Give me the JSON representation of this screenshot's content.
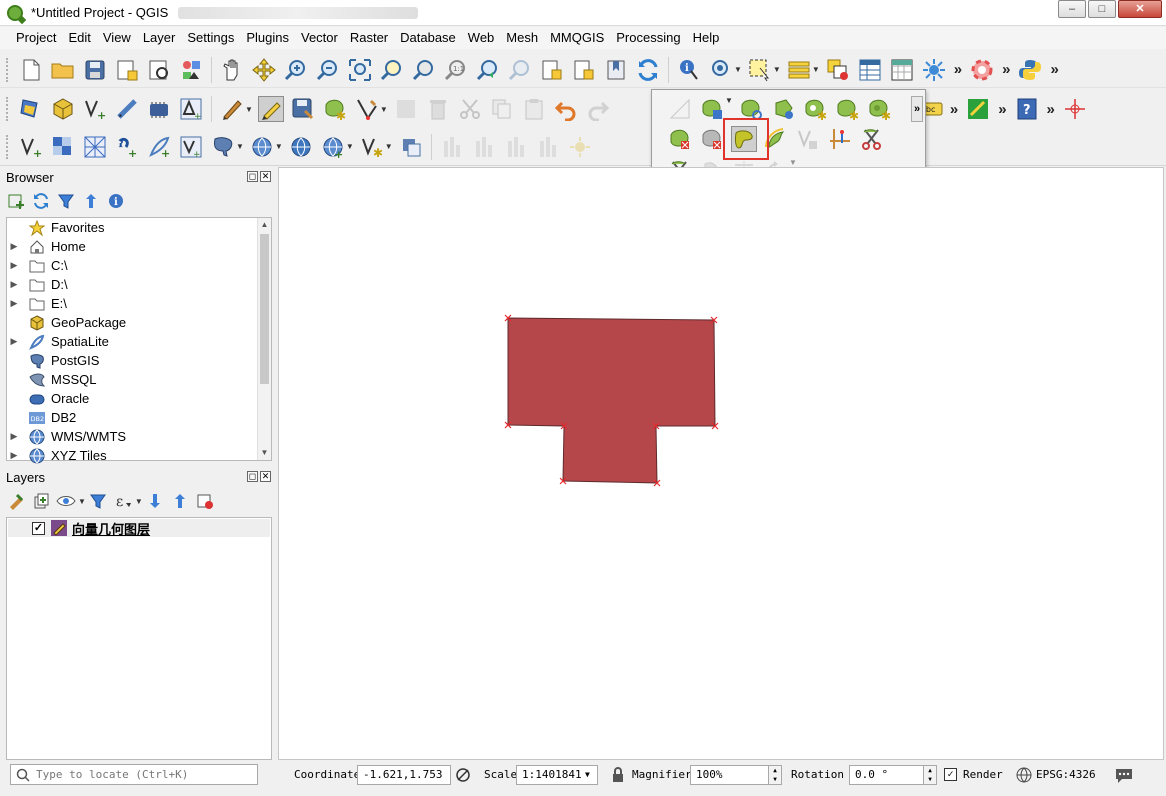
{
  "window": {
    "title": "*Untitled Project - QGIS",
    "controls": {
      "minimize": "–",
      "maximize": "□",
      "close": "✕"
    }
  },
  "menu": [
    "Project",
    "Edit",
    "View",
    "Layer",
    "Settings",
    "Plugins",
    "Vector",
    "Raster",
    "Database",
    "Web",
    "Mesh",
    "MMQGIS",
    "Processing",
    "Help"
  ],
  "toolbars": {
    "overflow_glyph": "»",
    "popup_highlighted_tool": "reshape-features-icon"
  },
  "browser": {
    "title": "Browser",
    "items": [
      {
        "label": "Favorites",
        "icon": "star-icon",
        "expandable": false
      },
      {
        "label": "Home",
        "icon": "home-icon",
        "expandable": true
      },
      {
        "label": "C:\\",
        "icon": "folder-icon",
        "expandable": true
      },
      {
        "label": "D:\\",
        "icon": "folder-icon",
        "expandable": true
      },
      {
        "label": "E:\\",
        "icon": "folder-icon",
        "expandable": true
      },
      {
        "label": "GeoPackage",
        "icon": "geopackage-icon",
        "expandable": false
      },
      {
        "label": "SpatiaLite",
        "icon": "spatialite-icon",
        "expandable": true
      },
      {
        "label": "PostGIS",
        "icon": "postgis-icon",
        "expandable": false
      },
      {
        "label": "MSSQL",
        "icon": "mssql-icon",
        "expandable": false
      },
      {
        "label": "Oracle",
        "icon": "oracle-icon",
        "expandable": false
      },
      {
        "label": "DB2",
        "icon": "db2-icon",
        "expandable": false
      },
      {
        "label": "WMS/WMTS",
        "icon": "globe-icon",
        "expandable": true
      },
      {
        "label": "XYZ Tiles",
        "icon": "globe-icon",
        "expandable": true
      }
    ],
    "db2_badge": "DB2"
  },
  "layers": {
    "title": "Layers",
    "items": [
      {
        "label": "向量几何图层",
        "checked": true,
        "check_glyph": "✓"
      }
    ]
  },
  "map": {
    "feature_fill": "#b5474b",
    "feature_stroke": "#5e2a2c",
    "vertex_color": "#e8282d"
  },
  "status": {
    "locator_placeholder": "Type to locate (Ctrl+K)",
    "coordinate_label": "Coordinate",
    "coordinate_value": "-1.621,1.753",
    "scale_label": "Scale",
    "scale_value": "1:1401841",
    "magnifier_label": "Magnifier",
    "magnifier_value": "100%",
    "rotation_label": "Rotation",
    "rotation_value": "0.0 °",
    "render_label": "Render",
    "render_checked": true,
    "render_check_glyph": "✓",
    "crs_label": "EPSG:4326"
  }
}
